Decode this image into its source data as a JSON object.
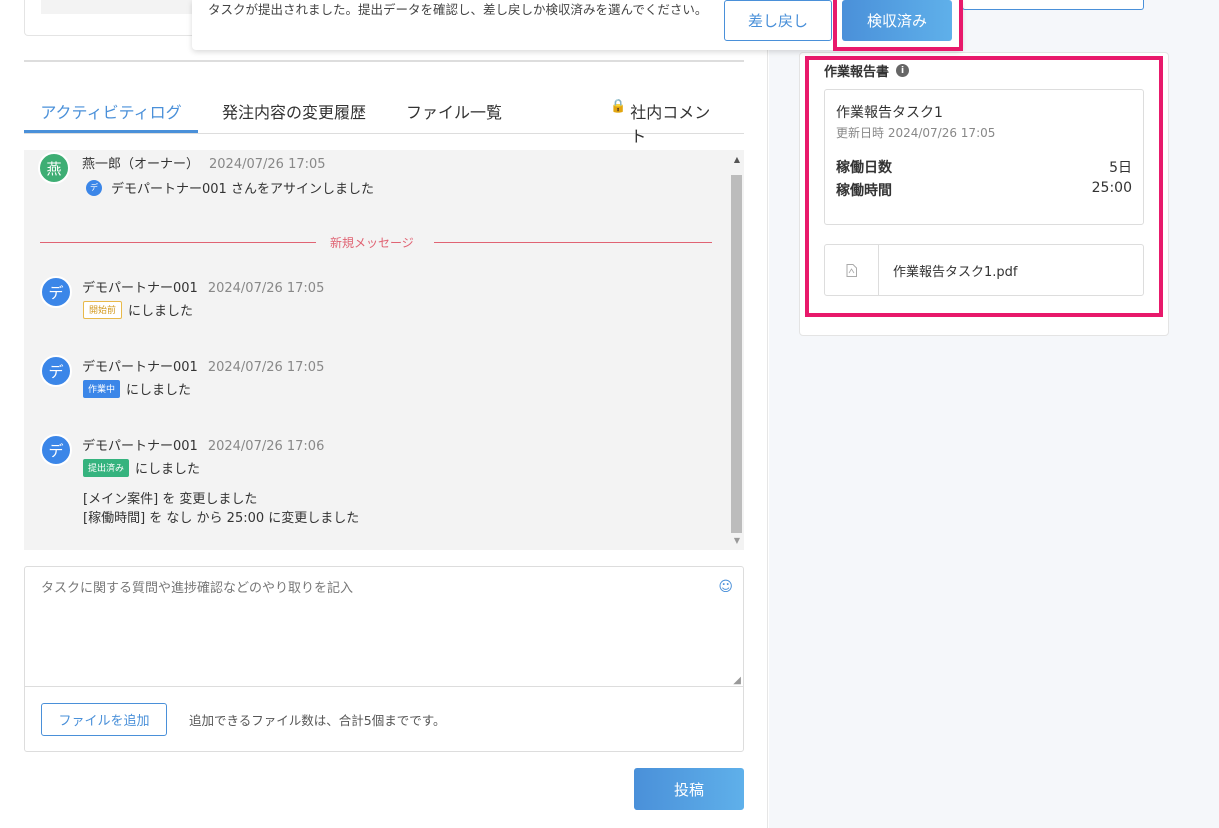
{
  "notice": {
    "text": "タスクが提出されました。提出データを確認し、差し戻しか検収済みを選んでください。",
    "return_label": "差し戻し",
    "accept_label": "検収済み"
  },
  "tabs": [
    {
      "label": "アクティビティログ"
    },
    {
      "label": "発注内容の変更履歴"
    },
    {
      "label": "ファイル一覧"
    },
    {
      "label": "社内コメント"
    }
  ],
  "log": {
    "entry1": {
      "avatar": "燕",
      "name": "燕一郎（オーナー）",
      "time": "2024/07/26 17:05",
      "mini": "デ",
      "text": "デモパートナー001 さんをアサインしました"
    },
    "new_message_label": "新規メッセージ",
    "entry2": {
      "avatar": "デ",
      "name": "デモパートナー001",
      "time": "2024/07/26 17:05",
      "badge": "開始前",
      "text": "にしました"
    },
    "entry3": {
      "avatar": "デ",
      "name": "デモパートナー001",
      "time": "2024/07/26 17:05",
      "badge": "作業中",
      "text": "にしました"
    },
    "entry4": {
      "avatar": "デ",
      "name": "デモパートナー001",
      "time": "2024/07/26 17:06",
      "badge": "提出済み",
      "text": "にしました",
      "line2": "[メイン案件] を 変更しました",
      "line3": "[稼働時間] を なし から 25:00 に変更しました"
    }
  },
  "compose": {
    "placeholder": "タスクに関する質問や進捗確認などのやり取りを記入",
    "add_file_label": "ファイルを追加",
    "file_note": "追加できるファイル数は、合計5個までです。",
    "post_label": "投稿"
  },
  "report": {
    "title": "作業報告書",
    "name": "作業報告タスク1",
    "updated": "更新日時 2024/07/26 17:05",
    "days_label": "稼働日数",
    "days_value": "5日",
    "hours_label": "稼働時間",
    "hours_value": "25:00",
    "file_name": "作業報告タスク1.pdf"
  },
  "colors": {
    "accent": "#4a90d9",
    "highlight": "#e8196b",
    "new_message": "#e06373"
  }
}
